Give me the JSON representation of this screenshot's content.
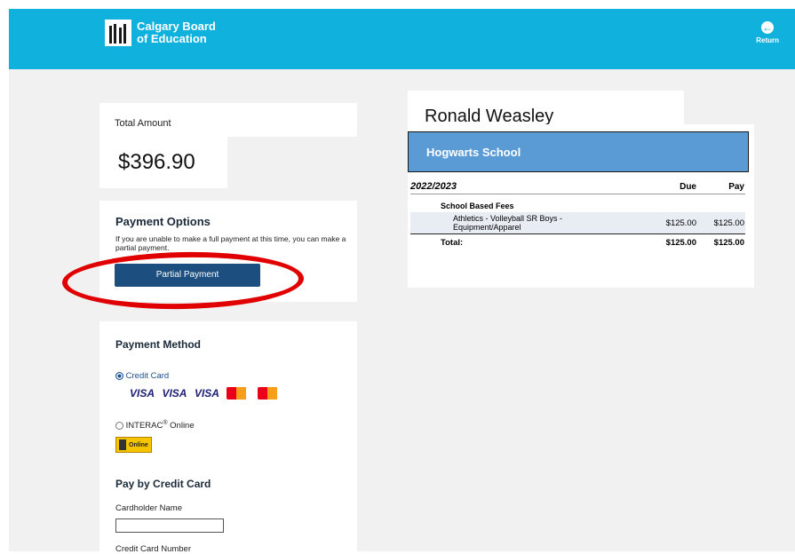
{
  "header": {
    "logo_line1": "Calgary Board",
    "logo_line2": "of Education",
    "return_label": "Return"
  },
  "total": {
    "label": "Total Amount",
    "amount": "$396.90"
  },
  "payment_options": {
    "title": "Payment Options",
    "text": "If you are unable to make a full payment at this time, you can make a partial payment.",
    "button": "Partial Payment"
  },
  "payment_method": {
    "title": "Payment Method",
    "credit_card": "Credit Card",
    "interac": "INTERAC",
    "interac_sup": "®",
    "interac_suffix": " Online",
    "card_logos": [
      "VISA",
      "VISA",
      "VISA"
    ],
    "interac_badge": "Online"
  },
  "pay_by_card": {
    "title": "Pay by Credit Card",
    "cardholder_label": "Cardholder Name",
    "cardholder_value": "",
    "card_number_label": "Credit Card Number"
  },
  "student": {
    "name": "Ronald Weasley",
    "school": "Hogwarts School",
    "year": "2022/2023",
    "col_due": "Due",
    "col_pay": "Pay",
    "section": "School Based Fees",
    "item_line1": "Athletics - Volleyball SR Boys -",
    "item_line2": "Equipment/Apparel",
    "item_due": "$125.00",
    "item_pay": "$125.00",
    "total_label": "Total:",
    "total_due": "$125.00",
    "total_pay": "$125.00"
  },
  "colors": {
    "header": "#11b1de",
    "school_bar": "#5b9bd5",
    "button": "#1c4f7f",
    "annotation": "#e00000"
  }
}
